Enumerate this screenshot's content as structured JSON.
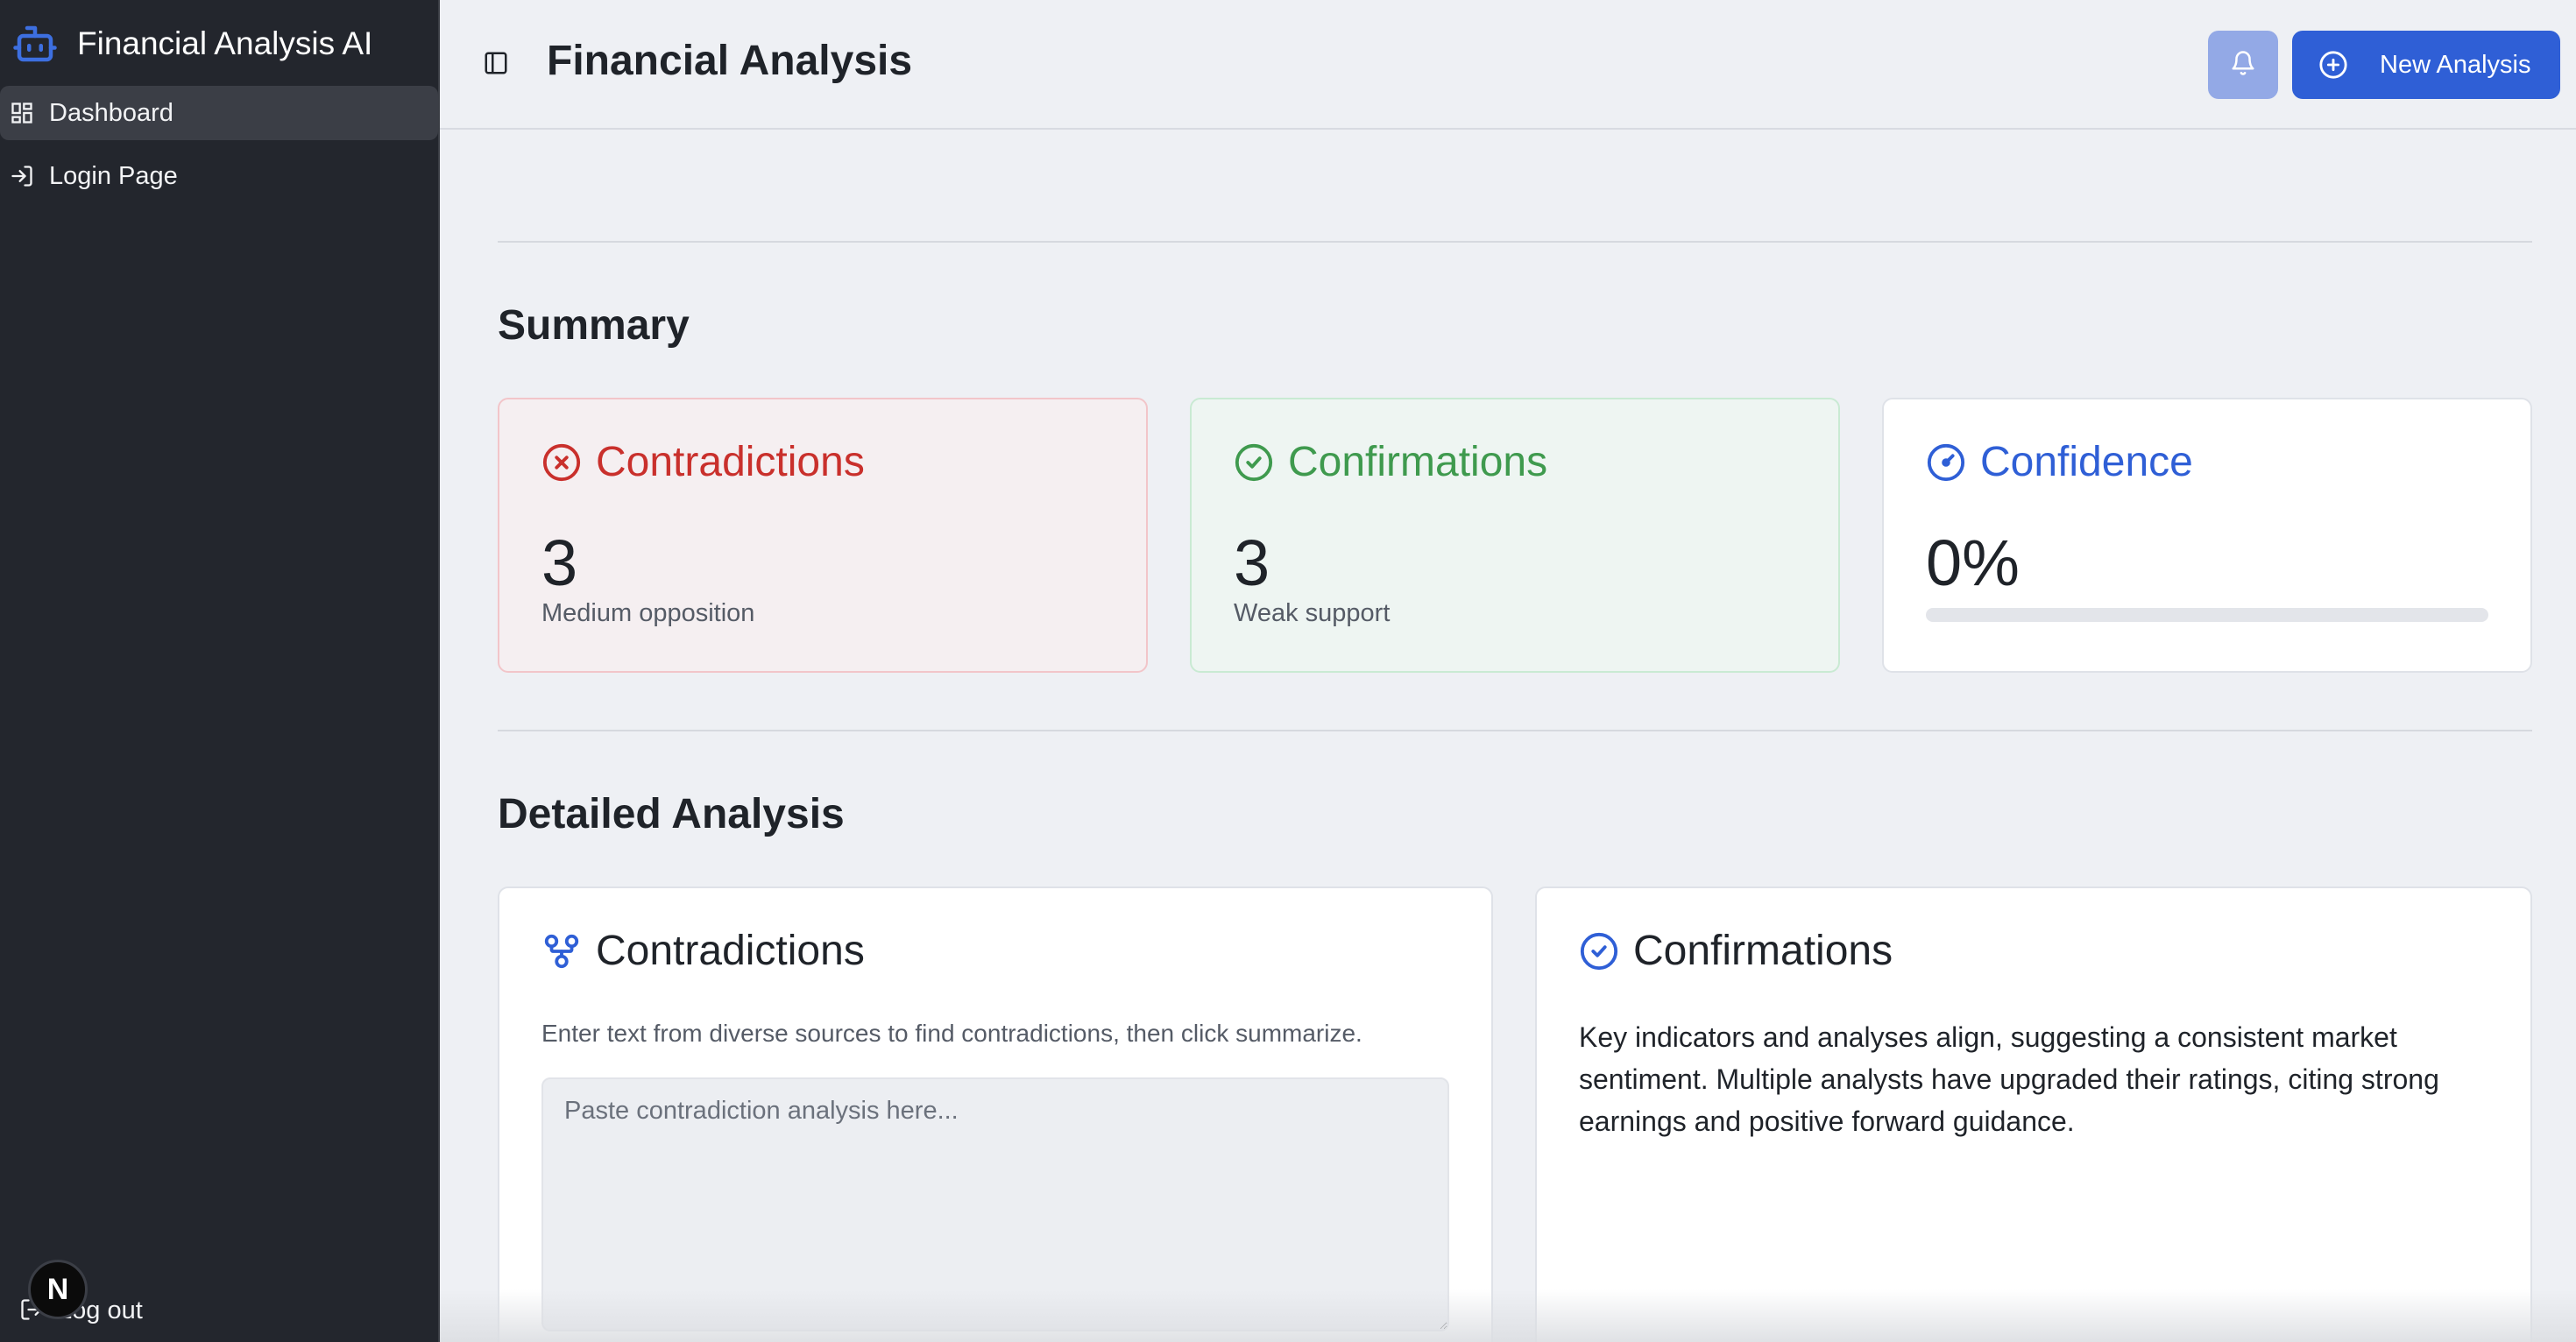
{
  "app": {
    "title": "Financial Analysis AI"
  },
  "sidebar": {
    "items": [
      {
        "label": "Dashboard",
        "icon": "dashboard-icon",
        "active": true
      },
      {
        "label": "Login Page",
        "icon": "login-icon",
        "active": false
      }
    ],
    "logout_label": "Log out",
    "badge_letter": "N"
  },
  "header": {
    "title": "Financial Analysis",
    "new_button_label": "New Analysis"
  },
  "summary": {
    "title": "Summary",
    "contradictions": {
      "title": "Contradictions",
      "count": "3",
      "note": "Medium opposition",
      "color": "#c9302c"
    },
    "confirmations": {
      "title": "Confirmations",
      "count": "3",
      "note": "Weak support",
      "color": "#3f9a4e"
    },
    "confidence": {
      "title": "Confidence",
      "value": "0%",
      "progress": 0,
      "color": "#2f5fd6"
    }
  },
  "detailed": {
    "title": "Detailed Analysis",
    "contradictions": {
      "title": "Contradictions",
      "description": "Enter text from diverse sources to find contradictions, then click summarize.",
      "placeholder": "Paste contradiction analysis here..."
    },
    "confirmations": {
      "title": "Confirmations",
      "text": "Key indicators and analyses align, suggesting a consistent market sentiment. Multiple analysts have upgraded their ratings, citing strong earnings and positive forward guidance."
    }
  }
}
